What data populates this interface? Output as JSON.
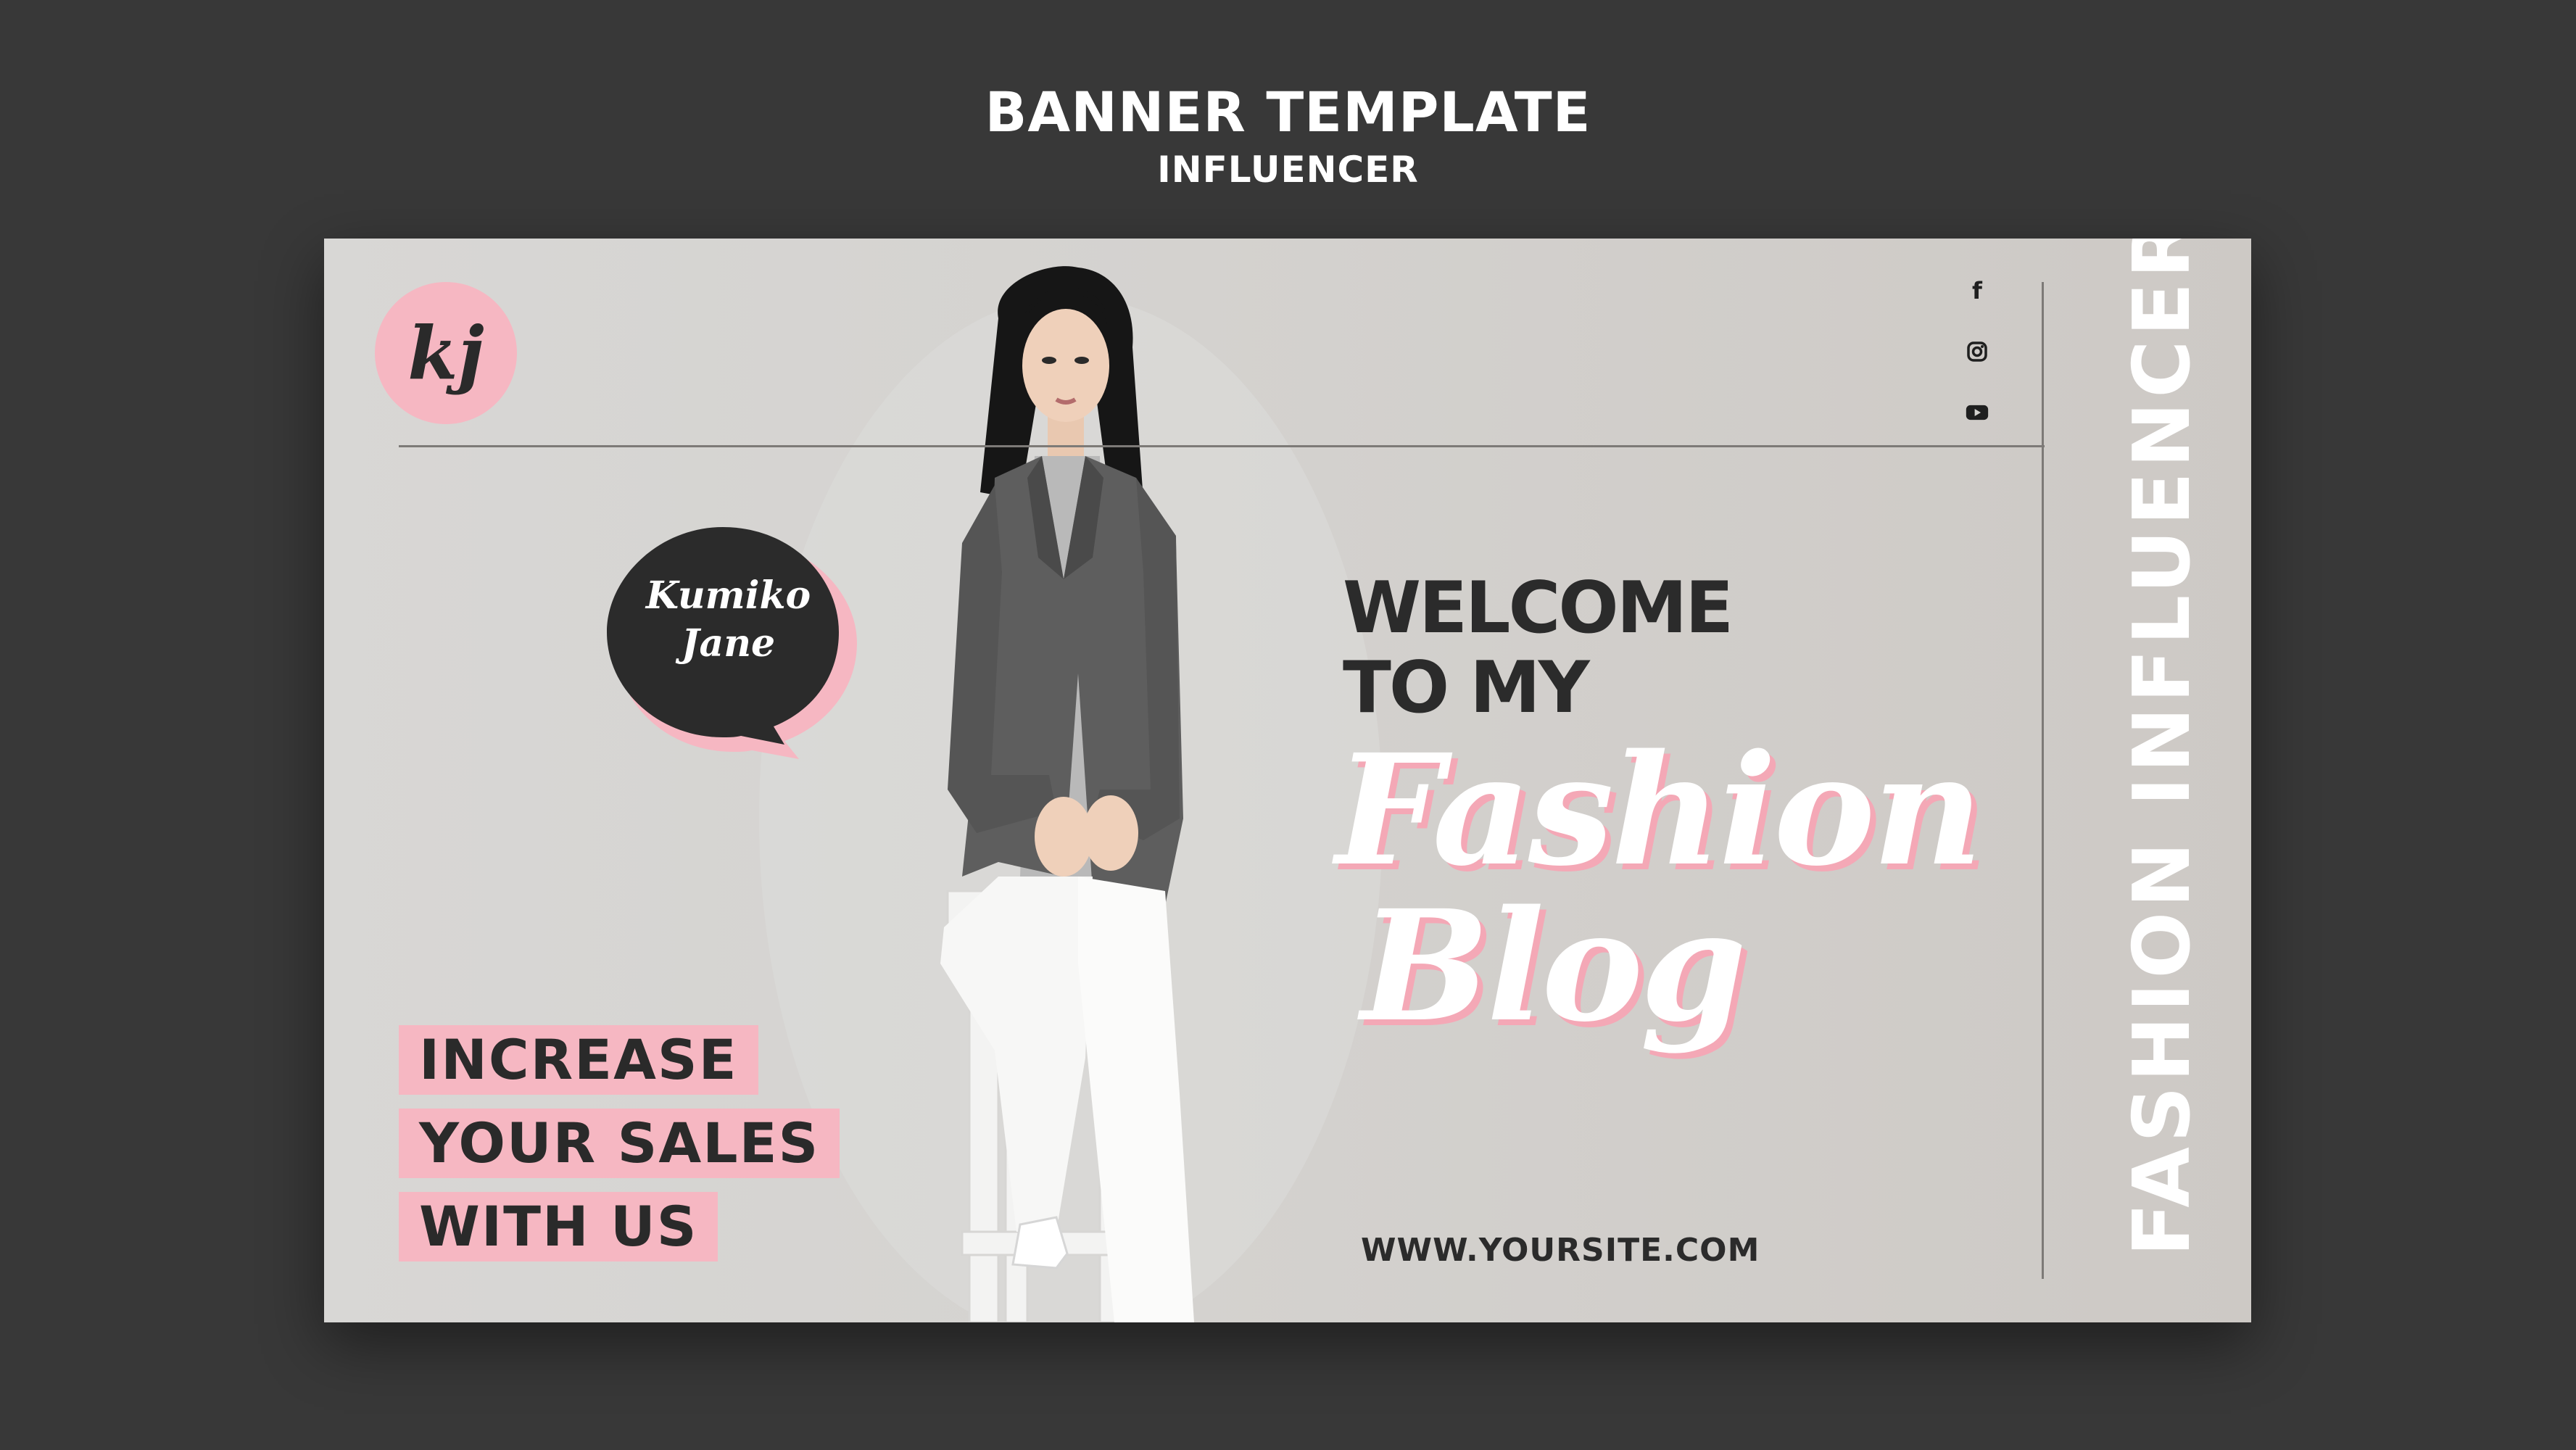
{
  "header": {
    "title": "BANNER TEMPLATE",
    "subtitle": "INFLUENCER"
  },
  "banner": {
    "logo_initials": "kj",
    "social_icons": [
      "facebook-icon",
      "instagram-icon",
      "youtube-icon"
    ],
    "vertical_text": "FASHION INFLUENCER",
    "name_bubble": {
      "line1": "Kumiko",
      "line2": "Jane"
    },
    "welcome": {
      "line1": "WELCOME",
      "line2": "TO MY"
    },
    "script": {
      "line1": "Fashion",
      "line2": "Blog"
    },
    "promo": [
      "INCREASE",
      "YOUR SALES",
      "WITH US"
    ],
    "website": "WWW.YOURSITE.COM"
  },
  "colors": {
    "background": "#383838",
    "banner": "#d4d2cf",
    "accent_pink": "#f6b7c2",
    "dark": "#2b2b2b",
    "white": "#ffffff"
  }
}
